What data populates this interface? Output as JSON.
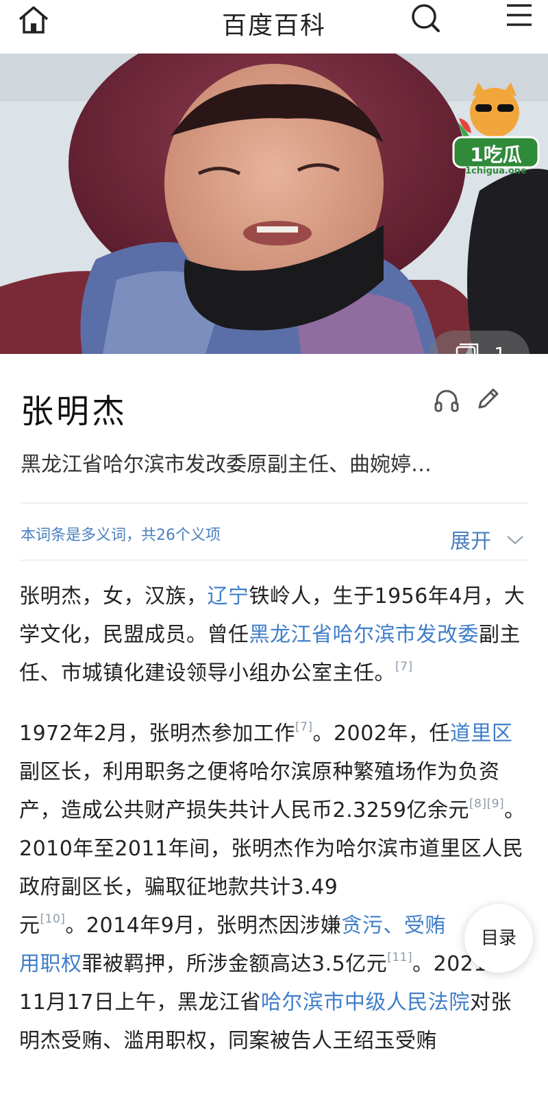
{
  "header": {
    "title": "百度百科"
  },
  "hero": {
    "photo_count": "1",
    "badge_main": "1吃瓜",
    "badge_sub": "1chigua.one"
  },
  "entry": {
    "name": "张明杰",
    "subtitle": "黑龙江省哈尔滨市发改委原副主任、曲婉婷…",
    "polysemy_note": "本词条是多义词，共26个义项",
    "expand_label": "展开"
  },
  "paragraph1": {
    "t1": "张明杰，女，汉族，",
    "link1": "辽宁",
    "t2": "铁岭人，生于1956年4月，大学文化，民盟成员。曾任",
    "link2": "黑龙江省哈尔滨市发改委",
    "t3": "副主任、市城镇化建设领导小组办公室主任。",
    "ref1": "[7]"
  },
  "paragraph2": {
    "t1": "1972年2月，张明杰参加工作",
    "ref1": "[7]",
    "t2": "。2002年，任",
    "link1": "道里区",
    "t3": "副区长，利用职务之便将哈尔滨原种繁殖场作为负资产，造成公共财产损失共计人民币2.3259亿余元",
    "ref2": "[8][9]",
    "t4": "。2010年至2011年间，张明杰作为哈尔滨市道里区人民政府副区长，骗取征地款共计3.49",
    "t5": "元",
    "ref3": "[10]",
    "t6": "。2014年9月，张明杰因涉嫌",
    "link2": "贪污",
    "t7": "、",
    "link3": "受贿",
    "link4": "用职权",
    "t8": "罪被羁押，所涉金额高达3.5亿元",
    "ref4": "[11]",
    "t9": "。2021年11月17日上午，黑龙江省",
    "link5": "哈尔滨市中级人民法院",
    "t10": "对张明杰受贿、滥用职权，同案被告人王绍玉受贿"
  },
  "toc": {
    "label": "目录"
  }
}
